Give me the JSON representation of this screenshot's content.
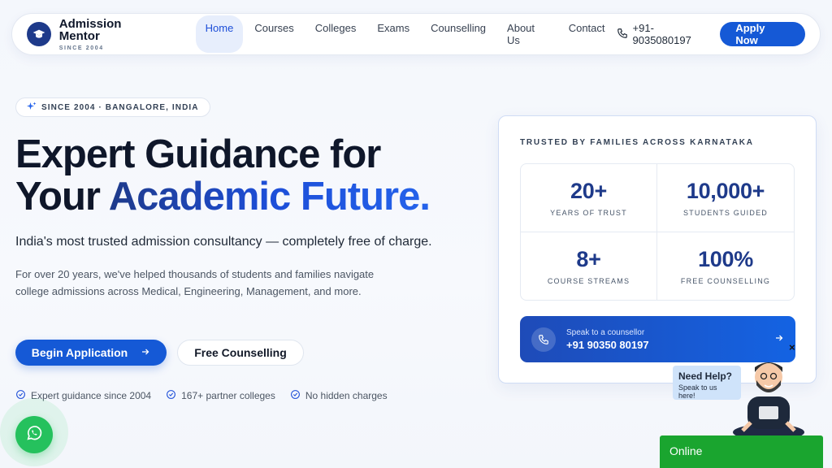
{
  "nav": {
    "brand_name": "Admission Mentor",
    "brand_since": "SINCE 2004",
    "menu": [
      {
        "label": "Home",
        "active": true
      },
      {
        "label": "Courses",
        "active": false
      },
      {
        "label": "Colleges",
        "active": false
      },
      {
        "label": "Exams",
        "active": false
      },
      {
        "label": "Counselling",
        "active": false
      },
      {
        "label": "About Us",
        "active": false
      },
      {
        "label": "Contact",
        "active": false
      }
    ],
    "phone": "+91-9035080197",
    "apply_label": "Apply Now"
  },
  "hero": {
    "since_pill": "SINCE 2004 · BANGALORE, INDIA",
    "headline_line1": "Expert Guidance for",
    "headline_line2_plain": "Your ",
    "headline_line2_accent": "Academic Future.",
    "tagline": "India's most trusted admission consultancy — completely free of charge.",
    "description": "For over 20 years, we've helped thousands of students and families navigate college admissions across Medical, Engineering, Management, and more.",
    "cta_primary": "Begin Application",
    "cta_secondary": "Free Counselling",
    "features": [
      "Expert guidance since 2004",
      "167+ partner colleges",
      "No hidden charges"
    ]
  },
  "stats_card": {
    "eyebrow": "TRUSTED BY FAMILIES ACROSS KARNATAKA",
    "stats": [
      {
        "value": "20+",
        "label": "YEARS OF TRUST"
      },
      {
        "value": "10,000+",
        "label": "STUDENTS GUIDED"
      },
      {
        "value": "8+",
        "label": "COURSE STREAMS"
      },
      {
        "value": "100%",
        "label": "FREE COUNSELLING"
      }
    ],
    "speak_small": "Speak to a counsellor",
    "speak_number": "+91 90350 80197"
  },
  "help_widget": {
    "title": "Need Help?",
    "subtitle": "Speak to us here!",
    "close": "×",
    "status": "Online"
  },
  "colors": {
    "primary": "#1559d6",
    "navy": "#1e3a8a",
    "whatsapp": "#25c15d",
    "online_green": "#1aa52f"
  }
}
